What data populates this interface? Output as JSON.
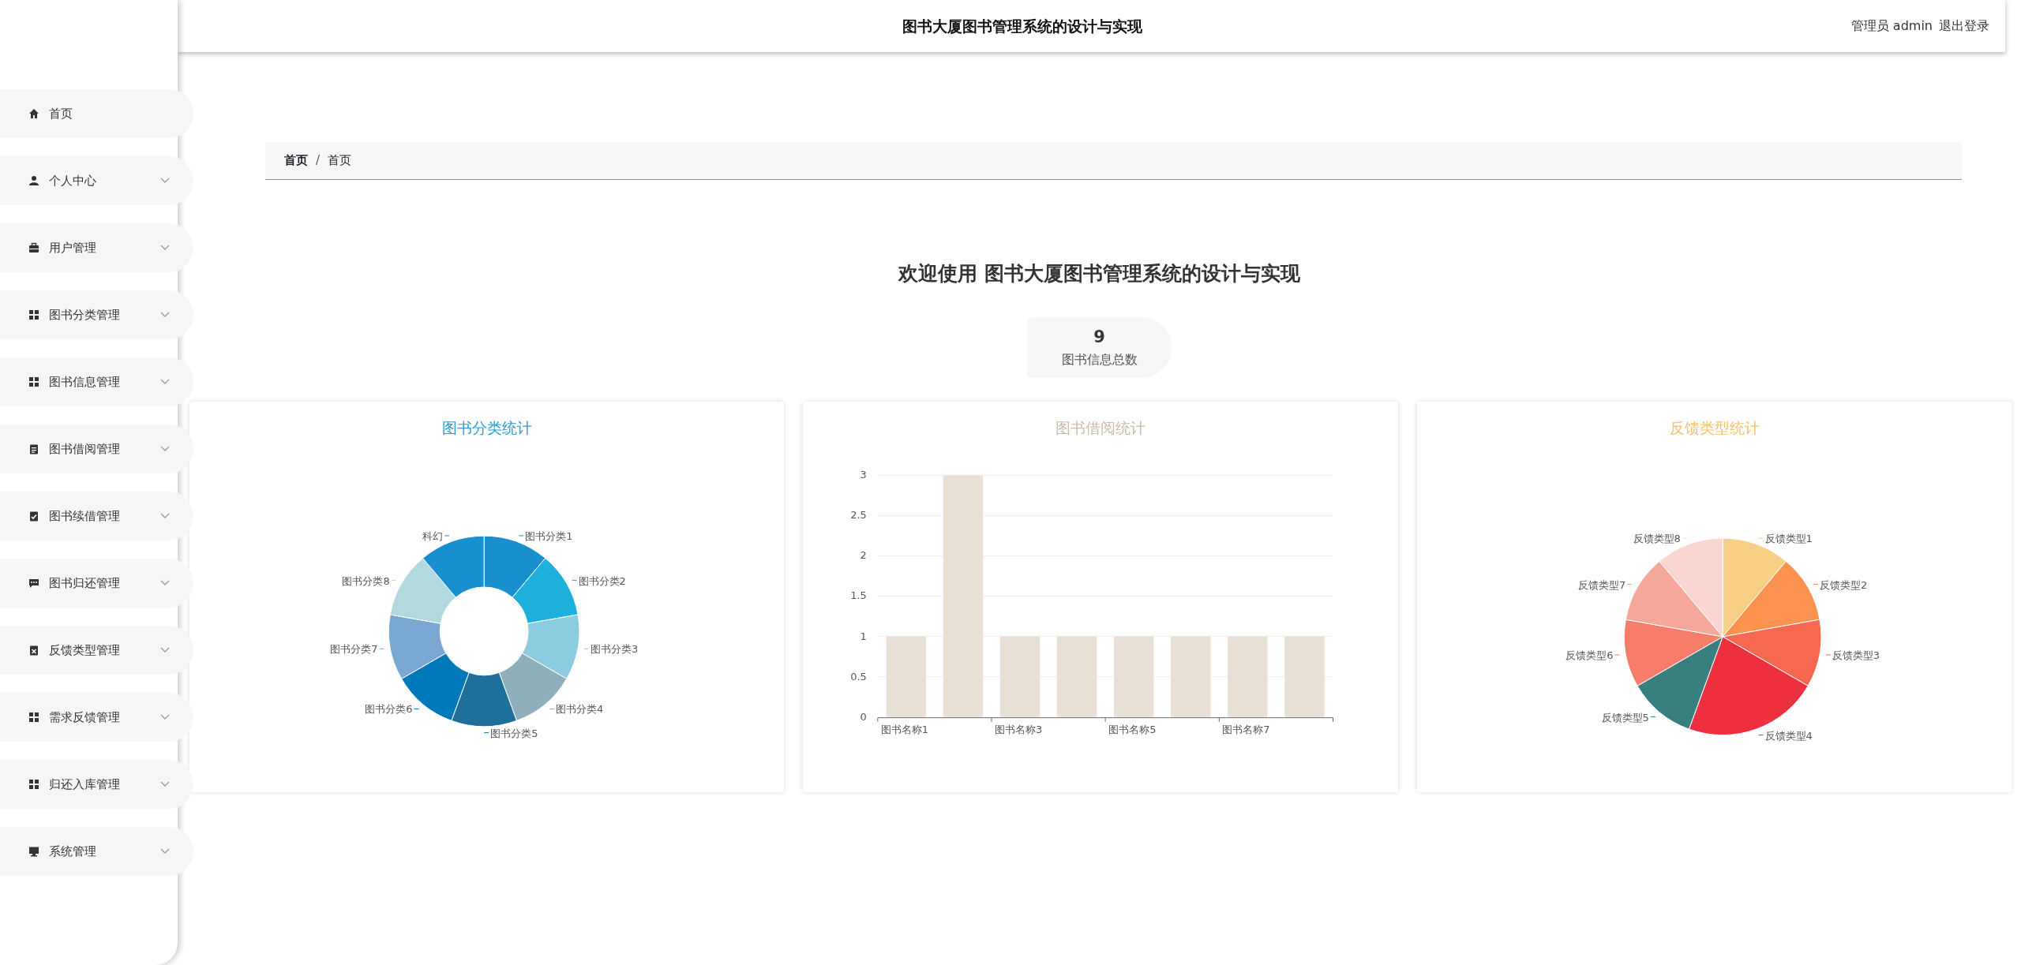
{
  "topbar": {
    "title": "图书大厦图书管理系统的设计与实现",
    "user": "管理员 admin",
    "logout": "退出登录"
  },
  "sidebar": {
    "items": [
      {
        "label": "首页",
        "expandable": false
      },
      {
        "label": "个人中心",
        "expandable": true
      },
      {
        "label": "用户管理",
        "expandable": true
      },
      {
        "label": "图书分类管理",
        "expandable": true
      },
      {
        "label": "图书信息管理",
        "expandable": true
      },
      {
        "label": "图书借阅管理",
        "expandable": true
      },
      {
        "label": "图书续借管理",
        "expandable": true
      },
      {
        "label": "图书归还管理",
        "expandable": true
      },
      {
        "label": "反馈类型管理",
        "expandable": true
      },
      {
        "label": "需求反馈管理",
        "expandable": true
      },
      {
        "label": "归还入库管理",
        "expandable": true
      },
      {
        "label": "系统管理",
        "expandable": true
      }
    ]
  },
  "breadcrumb": {
    "items": [
      "首页",
      "首页"
    ],
    "separator": "/"
  },
  "welcome": "欢迎使用 图书大厦图书管理系统的设计与实现",
  "stat": {
    "value": "9",
    "label": "图书信息总数"
  },
  "charts": [
    {
      "chart_data": {
        "type": "donut",
        "title": "图书分类统计",
        "categories": [
          "图书分类1",
          "图书分类2",
          "图书分类3",
          "图书分类4",
          "图书分类5",
          "图书分类6",
          "图书分类7",
          "图书分类8",
          "科幻"
        ],
        "values": [
          1,
          1,
          1,
          1,
          1,
          1,
          1,
          1,
          1
        ],
        "colors": [
          "#1a8fd0",
          "#1eb0dc",
          "#8ccbe0",
          "#8fafbd",
          "#1e6f9a",
          "#0079ba",
          "#7aa8d2",
          "#b3d9e0",
          "#1a8fd0"
        ]
      }
    },
    {
      "chart_data": {
        "type": "bar",
        "title": "图书借阅统计",
        "categories": [
          "图书名称1",
          null,
          "图书名称3",
          null,
          "图书名称5",
          null,
          "图书名称7",
          null
        ],
        "values": [
          1,
          3,
          1,
          1,
          1,
          1,
          1,
          1
        ],
        "color": "#e8e0d4",
        "ylim": [
          0,
          3
        ],
        "yticks": [
          0,
          0.5,
          1,
          1.5,
          2,
          2.5,
          3
        ],
        "grid": true
      }
    },
    {
      "chart_data": {
        "type": "pie",
        "title": "反馈类型统计",
        "categories": [
          "反馈类型1",
          "反馈类型2",
          "反馈类型3",
          "反馈类型4",
          "反馈类型5",
          "反馈类型6",
          "反馈类型7",
          "反馈类型8"
        ],
        "values": [
          1,
          1,
          1,
          2,
          1,
          1,
          1,
          1
        ],
        "colors": [
          "#f7cf85",
          "#fb9250",
          "#f76850",
          "#ee2f3d",
          "#3a7f7f",
          "#f57d6a",
          "#f5a89a",
          "#fbd5d2"
        ]
      }
    }
  ]
}
